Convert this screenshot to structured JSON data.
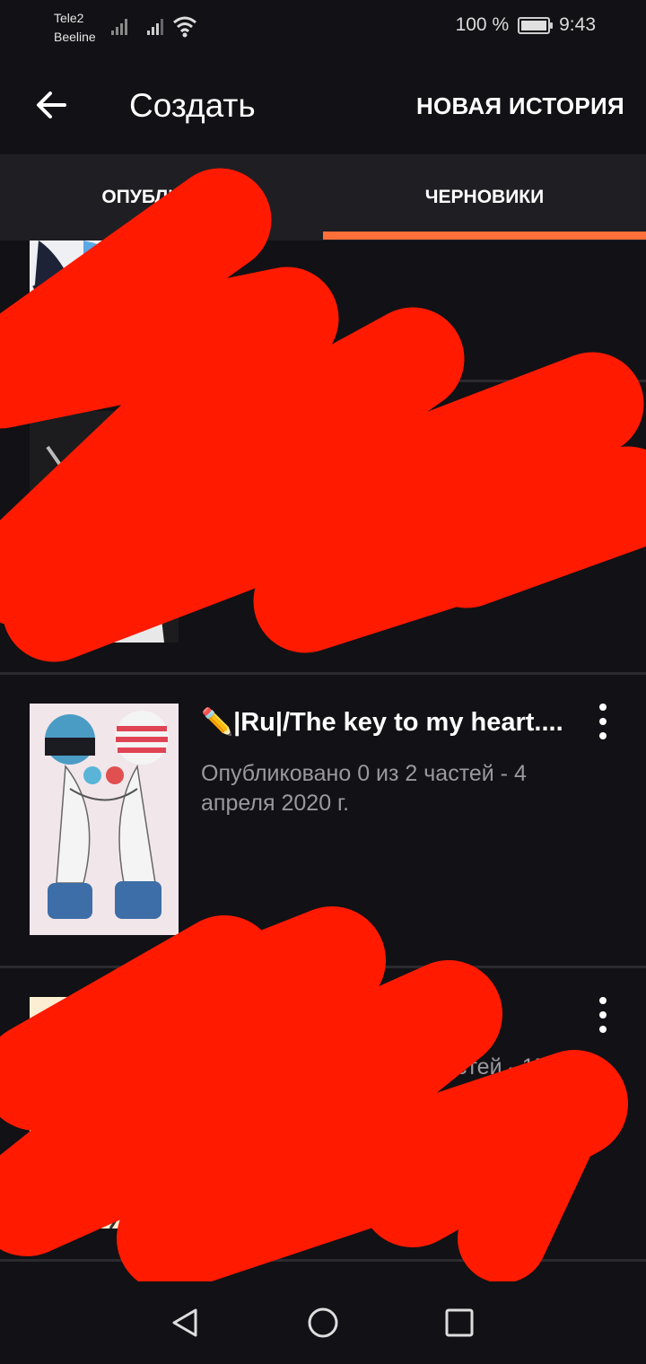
{
  "status_bar": {
    "carrier_1": "Tele2",
    "carrier_2": "Beeline",
    "battery": "100 %",
    "time": "9:43",
    "battery_level": 1.0
  },
  "app_bar": {
    "title": "Создать",
    "action": "НОВАЯ ИСТОРИЯ",
    "back_icon": "arrow-left-icon"
  },
  "tabs": {
    "published": "ОПУБЛИКОВ",
    "drafts": "ЧЕРНОВИКИ",
    "selected": "drafts"
  },
  "stories": [
    {
      "title": "",
      "meta": ""
    },
    {
      "title": "",
      "meta": ""
    },
    {
      "title": "✏️|Ru|/The key to my heart....",
      "meta": "Опубликовано 0 из 2 частей - 4 апреля 2020 г."
    },
    {
      "title": "ати",
      "meta": "стей - 15"
    }
  ],
  "colors": {
    "accent": "#ff6f3a",
    "background": "#121115",
    "tab_background": "#1f1e23",
    "meta_text": "#9a999e",
    "scribble": "#ff1a00"
  }
}
